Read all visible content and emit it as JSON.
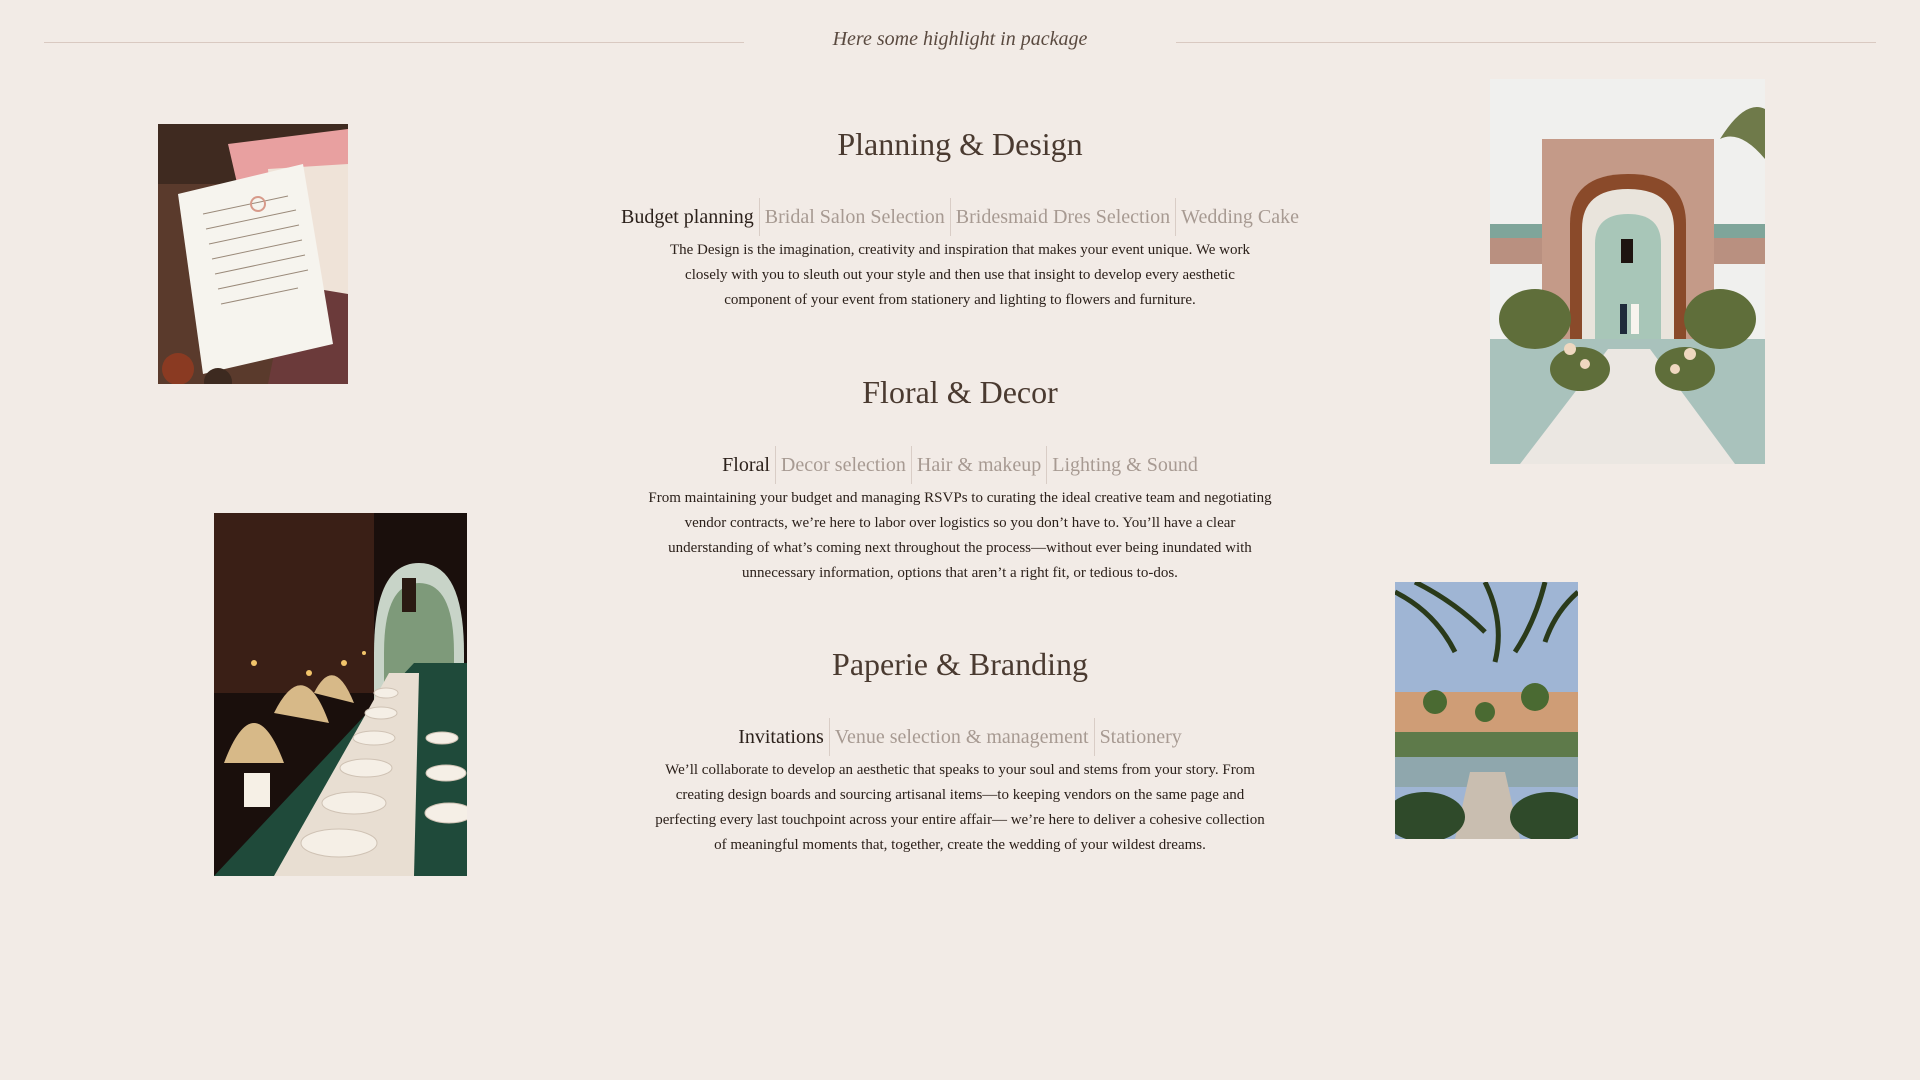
{
  "header": {
    "kicker": "Here some highlight in package"
  },
  "sections": [
    {
      "title": "Planning & Design",
      "tabs": [
        "Budget planning",
        "Bridal Salon Selection",
        "Bridesmaid Dres Selection",
        "Wedding Cake"
      ],
      "active_tab": "Budget planning",
      "description": "The Design is the imagination, creativity and inspiration that makes your event unique. We work closely with you to sleuth out your style and then use that insight to develop every aesthetic component of your event from stationery and lighting to flowers and furniture."
    },
    {
      "title": "Floral & Decor",
      "tabs": [
        "Floral",
        "Decor selection",
        "Hair & makeup",
        "Lighting & Sound"
      ],
      "active_tab": "Floral",
      "description": "From maintaining your budget and managing RSVPs to curating the ideal creative team and negotiating vendor contracts, we’re here to labor over logistics so you don’t have to. You’ll have a clear understanding of what’s coming next throughout the process—without ever being inundated with unnecessary information, options that aren’t a right fit, or tedious to-dos."
    },
    {
      "title": "Paperie & Branding",
      "tabs": [
        "Invitations",
        "Venue selection & management",
        "Stationery"
      ],
      "active_tab": "Invitations",
      "description": "We’ll collaborate to develop an aesthetic that speaks to your soul and stems from your story. From creating design boards and sourcing artisanal items—to keeping vendors on the same page and perfecting every last touchpoint across your entire affair— we’re here to deliver a cohesive collection of meaningful moments that, together, create the wedding of your wildest dreams."
    }
  ],
  "photos": [
    {
      "name": "invitation-stationery-photo",
      "subject": "invitation card on pink envelope"
    },
    {
      "name": "table-setting-photo",
      "subject": "long dinner table under arches"
    },
    {
      "name": "ceremony-arch-photo",
      "subject": "ceremony under Moroccan arch"
    },
    {
      "name": "garden-palms-photo",
      "subject": "garden with palm trees and pool"
    }
  ],
  "colors": {
    "background": "#f2ebe6",
    "heading": "#4a3a30",
    "tab_active": "#2c211b",
    "tab_inactive": "#a79a92",
    "rule": "#d9c9c1"
  }
}
